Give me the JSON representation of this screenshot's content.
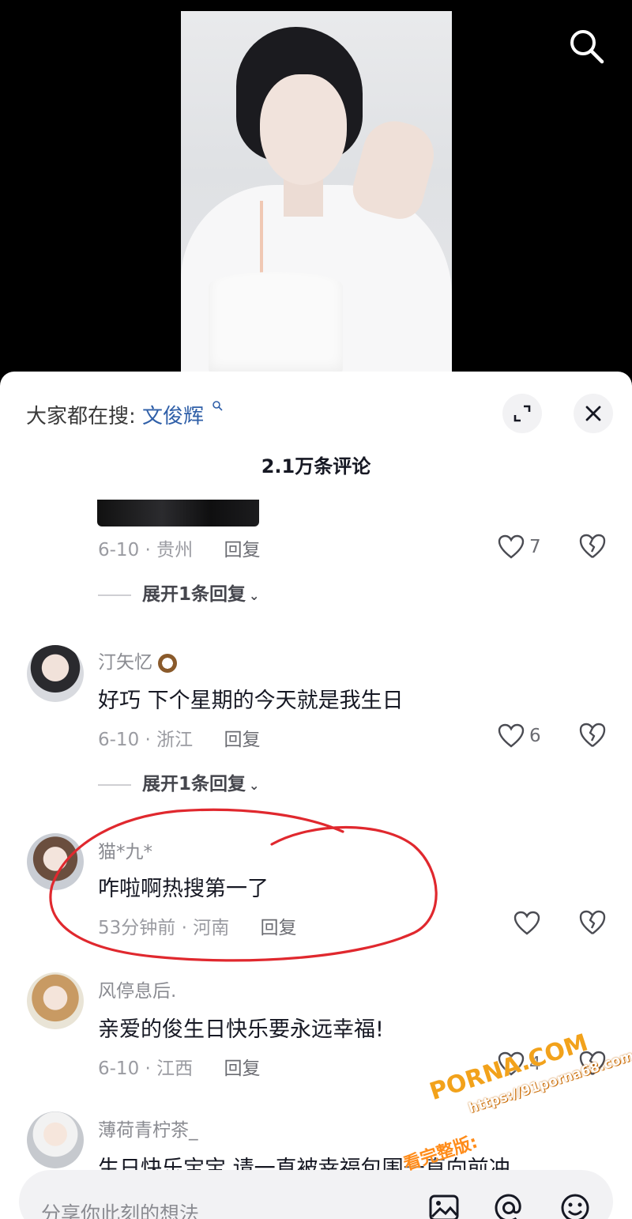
{
  "hot_search": {
    "label": "大家都在搜:",
    "keyword": "文俊辉",
    "keyword_icon": "search-icon"
  },
  "comment_count": "2.1万条评论",
  "comments": [
    {
      "meta_date": "6-10 · 贵州",
      "reply": "回复",
      "likes": "7",
      "expand": "展开1条回复"
    },
    {
      "author": "汀矢忆",
      "text": "好巧 下个星期的今天就是我生日",
      "meta_date": "6-10 · 浙江",
      "reply": "回复",
      "likes": "6",
      "expand": "展开1条回复"
    },
    {
      "author": "猫*九*",
      "text": "咋啦啊热搜第一了",
      "meta_date": "53分钟前 · 河南",
      "reply": "回复",
      "likes": ""
    },
    {
      "author": "风停息后.",
      "text": "亲爱的俊生日快乐要永远幸福!",
      "meta_date": "6-10 · 江西",
      "reply": "回复",
      "likes": "4"
    },
    {
      "author": "薄荷青柠茶_",
      "text": "生日快乐宝宝 请一直被幸福包围一直向前冲"
    }
  ],
  "input": {
    "placeholder": "分享你此刻的想法"
  },
  "watermark": {
    "logo": "PORNA.COM",
    "url": "https://91porna68.com",
    "sub": "看完整版:"
  },
  "colors": {
    "accent_link": "#2f5fa8",
    "highlight_ring": "#e0282e",
    "watermark": "#f2a21b"
  }
}
